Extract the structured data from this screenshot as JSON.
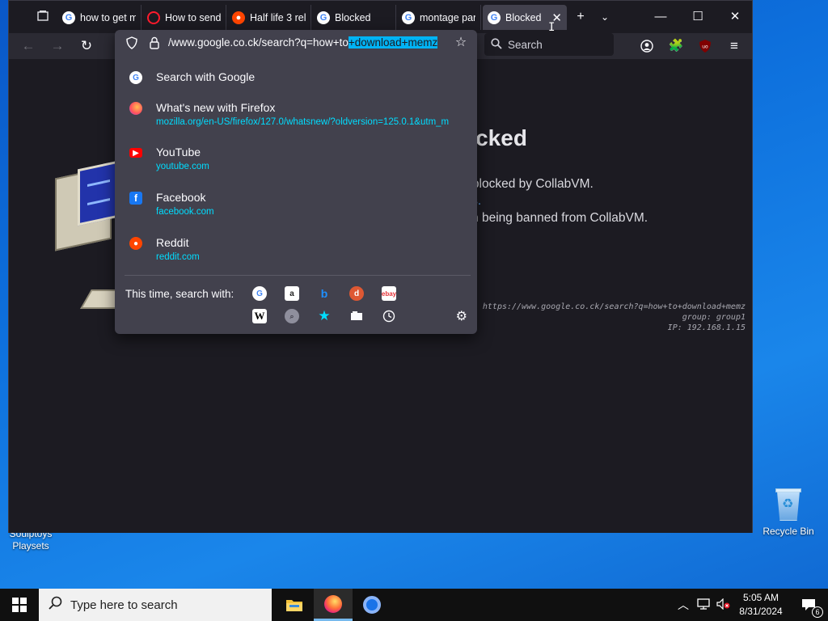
{
  "desktop": {
    "recycle_bin_label": "Recycle Bin",
    "partial_icon_label_1": "Soulptoys",
    "partial_icon_label_2": "Playsets"
  },
  "browser": {
    "tabs": [
      {
        "title": "how to get m",
        "favicon": "google-icon"
      },
      {
        "title": "How to send",
        "favicon": "opera-icon"
      },
      {
        "title": "Half life 3 rel",
        "favicon": "reddit-icon"
      },
      {
        "title": "Blocked",
        "favicon": "google-icon"
      },
      {
        "title": "montage par",
        "favicon": "google-icon"
      },
      {
        "title": "Blocked",
        "favicon": "google-icon",
        "active": true
      }
    ],
    "search_placeholder": "Search",
    "url_plain": "/www.google.co.ck/search?q=how+to",
    "url_selected": "+download+memz",
    "page": {
      "heading_partial": "ocked",
      "line1": "n blocked by CollabVM.",
      "line2": "ies.",
      "line3": "t in being banned from CollabVM.",
      "info_url": "https://www.google.co.ck/search?q=how+to+download+memz",
      "info_group": "group: group1",
      "info_ip": "IP: 192.168.1.15"
    },
    "suggestions": [
      {
        "title": "Search with Google",
        "url": "",
        "icon": "google-search-icon"
      },
      {
        "title": "What's new with Firefox",
        "url": "mozilla.org/en-US/firefox/127.0/whatsnew/?oldversion=125.0.1&utm_m",
        "icon": "firefox-icon"
      },
      {
        "title": "YouTube",
        "url": "youtube.com",
        "icon": "youtube-icon"
      },
      {
        "title": "Facebook",
        "url": "facebook.com",
        "icon": "facebook-icon"
      },
      {
        "title": "Reddit",
        "url": "reddit.com",
        "icon": "reddit-icon"
      }
    ],
    "search_with_label": "This time, search with:",
    "engines_row1": [
      "google-icon",
      "amazon-icon",
      "bing-icon",
      "duckduckgo-icon",
      "ebay-icon"
    ],
    "engines_row2": [
      "wikipedia-icon",
      "history-search-icon",
      "bookmarks-icon",
      "tabs-icon",
      "history-icon"
    ],
    "engine_ebay_text": "ebay",
    "engine_wiki_text": "W"
  },
  "taskbar": {
    "search_placeholder": "Type here to search",
    "time": "5:05 AM",
    "date": "8/31/2024",
    "notification_count": "6"
  },
  "colors": {
    "accent_selection": "#00b3f4",
    "url_link": "#00ddff",
    "window_bg": "#1c1b22",
    "popup_bg": "#42414d"
  }
}
